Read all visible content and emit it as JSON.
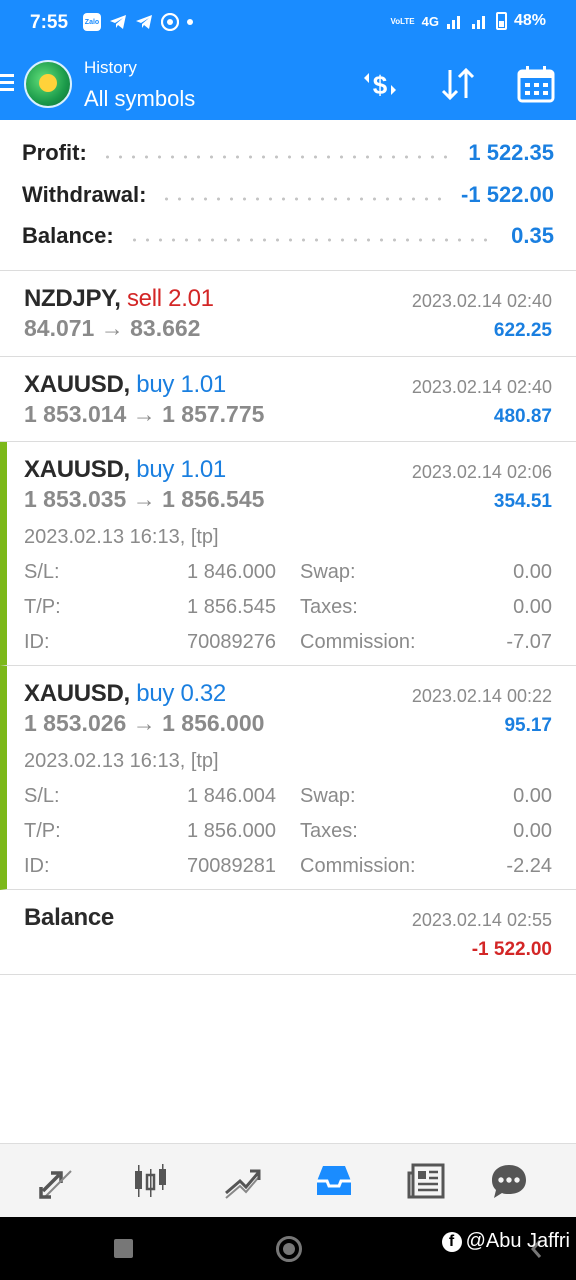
{
  "status_bar": {
    "time": "7:55",
    "zalo": "Zalo",
    "volte": "VoLTE",
    "network": "4G",
    "battery": "48%"
  },
  "header": {
    "subtitle": "History",
    "title": "All symbols",
    "icons": [
      "currency-exchange-icon",
      "sort-icon",
      "calendar-icon"
    ]
  },
  "summary": {
    "profit_label": "Profit:",
    "profit_value": "1 522.35",
    "withdrawal_label": "Withdrawal:",
    "withdrawal_value": "-1 522.00",
    "balance_label": "Balance:",
    "balance_value": "0.35"
  },
  "deals": [
    {
      "symbol": "NZDJPY,",
      "side": "sell 2.01",
      "prices": "84.071 → 83.662",
      "datetime": "2023.02.14 02:40",
      "profit": "622.25"
    },
    {
      "symbol": "XAUUSD,",
      "side": "buy 1.01",
      "prices": "1 853.014 → 1 857.775",
      "datetime": "2023.02.14 02:40",
      "profit": "480.87"
    },
    {
      "symbol": "XAUUSD,",
      "side": "buy 1.01",
      "prices": "1 853.035 → 1 856.545",
      "datetime": "2023.02.14 02:06",
      "profit": "354.51",
      "open_time": "2023.02.13 16:13, [tp]",
      "sl_label": "S/L:",
      "sl": "1 846.000",
      "tp_label": "T/P:",
      "tp": "1 856.545",
      "id_label": "ID:",
      "id": "70089276",
      "swap_label": "Swap:",
      "swap": "0.00",
      "taxes_label": "Taxes:",
      "taxes": "0.00",
      "commission_label": "Commission:",
      "commission": "-7.07"
    },
    {
      "symbol": "XAUUSD,",
      "side": "buy 0.32",
      "prices": "1 853.026 → 1 856.000",
      "datetime": "2023.02.14 00:22",
      "profit": "95.17",
      "open_time": "2023.02.13 16:13, [tp]",
      "sl_label": "S/L:",
      "sl": "1 846.004",
      "tp_label": "T/P:",
      "tp": "1 856.000",
      "id_label": "ID:",
      "id": "70089281",
      "swap_label": "Swap:",
      "swap": "0.00",
      "taxes_label": "Taxes:",
      "taxes": "0.00",
      "commission_label": "Commission:",
      "commission": "-2.24"
    }
  ],
  "balance_op": {
    "label": "Balance",
    "datetime": "2023.02.14 02:55",
    "amount": "-1 522.00"
  },
  "bottom_nav": [
    "quotes-icon",
    "chart-icon",
    "trade-icon",
    "history-icon",
    "news-icon",
    "chat-icon"
  ],
  "watermark": "@Abu Jaffri",
  "colors": {
    "header": "#1a8cff",
    "profit_blue": "#1a7fe0",
    "loss_red": "#d32626",
    "expanded_bar": "#7cb81a"
  }
}
